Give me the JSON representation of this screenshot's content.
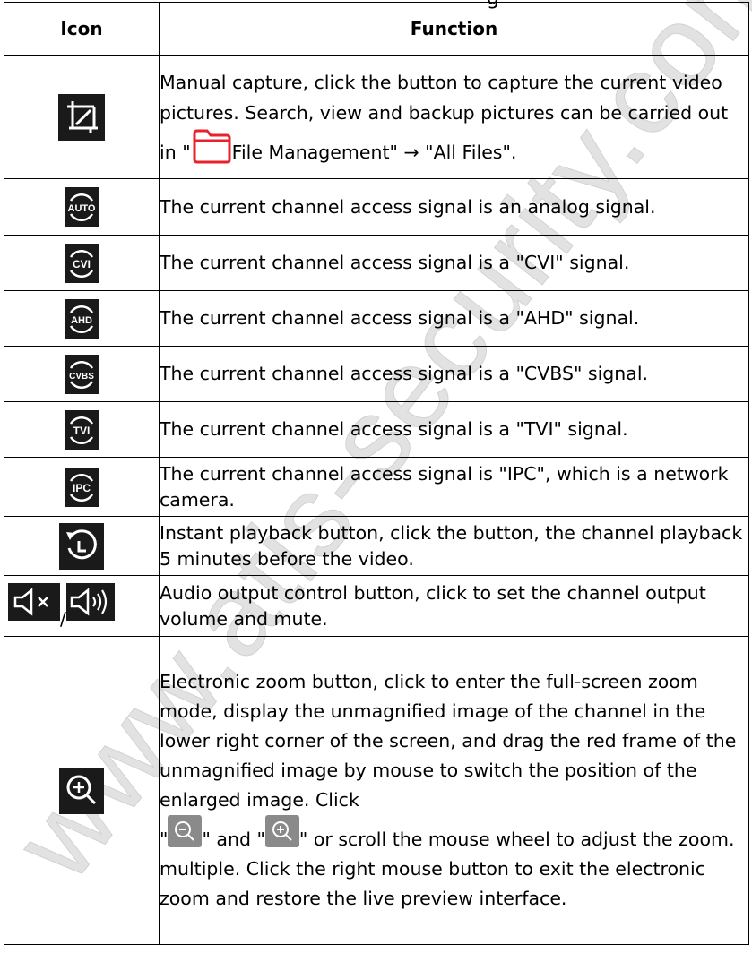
{
  "page_header_fragment": "g",
  "table": {
    "headers": {
      "icon": "Icon",
      "function": "Function"
    },
    "rows": [
      {
        "icon": "manual-capture-icon",
        "text_a": "Manual capture, click the button to capture the current video pictures. Search, view and backup pictures can be carried out in \"",
        "text_b": "File Management\" → \"All Files\"."
      },
      {
        "icon": "auto-signal-icon",
        "icon_label": "AUTO",
        "text": "The current channel access signal is an analog signal."
      },
      {
        "icon": "cvi-signal-icon",
        "icon_label": "CVI",
        "text": "The current channel access signal is a \"CVI\" signal."
      },
      {
        "icon": "ahd-signal-icon",
        "icon_label": "AHD",
        "text": "The current channel access signal is a \"AHD\" signal."
      },
      {
        "icon": "cvbs-signal-icon",
        "icon_label": "CVBS",
        "text": "The current channel access signal is a \"CVBS\" signal."
      },
      {
        "icon": "tvi-signal-icon",
        "icon_label": "TVI",
        "text": "The current channel access signal is a \"TVI\" signal."
      },
      {
        "icon": "ipc-signal-icon",
        "icon_label": "IPC",
        "text": "The current channel access signal is \"IPC\", which is a network camera."
      },
      {
        "icon": "instant-playback-icon",
        "text": "Instant playback button, click the button, the channel playback 5 minutes before the video."
      },
      {
        "icon": "audio-output-icons",
        "separator": "/",
        "text": "Audio output control button, click to set the channel output volume and mute."
      },
      {
        "icon": "electronic-zoom-icon",
        "text_a": "Electronic zoom button, click to enter the full-screen zoom mode, display the unmagnified image of the channel in the lower right corner of the screen, and drag the red frame of the unmagnified image by mouse to switch the position of the enlarged image. Click",
        "quote_open": "\"",
        "text_mid": "\" and \"",
        "text_b": "\" or scroll the mouse wheel to adjust the zoom. multiple. Click the right mouse button to exit the electronic zoom and restore the live preview interface."
      }
    ]
  },
  "watermark": "www.atis-security.com",
  "colors": {
    "icon_bg": "#1a1a1a",
    "folder_red": "#e8222a",
    "zoom_btn_bg": "#8a8a8a",
    "watermark": "#d9d9d9"
  }
}
